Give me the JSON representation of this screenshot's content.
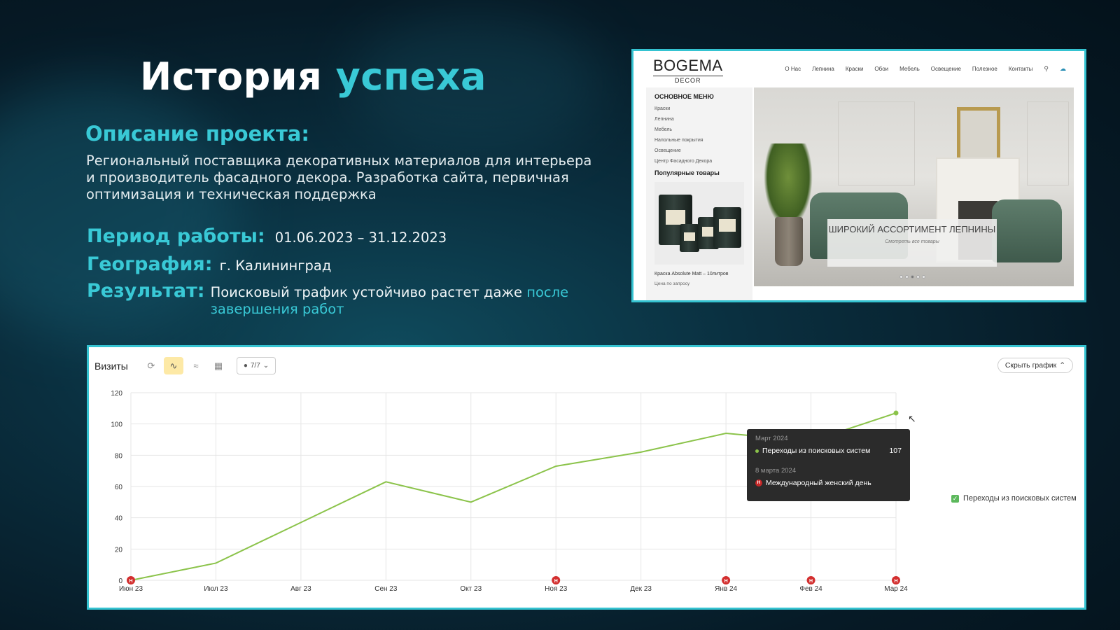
{
  "slide": {
    "title_main": "История",
    "title_accent": "успеха",
    "subhead": "Описание проекта:",
    "description": "Региональный поставщика декоративных материалов для интерьера и производитель фасадного декора. Разработка сайта, первичная оптимизация и техническая поддержка",
    "period_label": "Период работы:",
    "period_value": "01.06.2023 – 31.12.2023",
    "geo_label": "География:",
    "geo_value": "г. Калининград",
    "result_label": "Результат:",
    "result_text": "Поисковый трафик устойчиво растет даже ",
    "result_highlight": "после завершения работ",
    "accent_color": "#39c9d6"
  },
  "site": {
    "logo_main": "BOGEMA",
    "logo_sub": "DECOR",
    "nav": [
      "О Нас",
      "Лепнина",
      "Краски",
      "Обои",
      "Мебель",
      "Освещение",
      "Полезное",
      "Контакты"
    ],
    "sidebar_heading": "ОСНОВНОЕ МЕНЮ",
    "sidebar_items": [
      "Краски",
      "Лепнина",
      "Мебель",
      "Напольные покрытия",
      "Освещение",
      "Центр Фасадного Декора"
    ],
    "popular_heading": "Популярные товары",
    "product_name": "Краска Absolute Matt – 10литров",
    "product_price": "Цена по запросу",
    "banner_title": "ШИРОКИЙ АССОРТИМЕНТ ЛЕПНИНЫ",
    "banner_link": "Смотреть все товары"
  },
  "panel": {
    "title": "Визиты",
    "dropdown_value": "7/7",
    "hide_button": "Скрыть график",
    "legend_label": "Переходы из поисковых систем",
    "tooltip": {
      "month": "Март 2024",
      "series": "Переходы из поисковых систем",
      "value": "107",
      "event_date": "8 марта 2024",
      "event_badge": "Н",
      "event_name": "Международный женский день"
    }
  },
  "chart_data": {
    "type": "line",
    "x": [
      "Июн 23",
      "Июл 23",
      "Авг 23",
      "Сен 23",
      "Окт 23",
      "Ноя 23",
      "Дек 23",
      "Янв 24",
      "Фев 24",
      "Мар 24"
    ],
    "series": [
      {
        "name": "Переходы из поисковых систем",
        "values": [
          0,
          11,
          37,
          63,
          50,
          73,
          82,
          94,
          89,
          107
        ],
        "color": "#8bc34a"
      }
    ],
    "yticks": [
      0,
      20,
      40,
      60,
      80,
      100,
      120
    ],
    "ylim": [
      0,
      120
    ],
    "grid": true,
    "event_markers": [
      "Июн 23",
      "Ноя 23",
      "Янв 24",
      "Фев 24",
      "Мар 24"
    ],
    "marker_label": "Н",
    "legend": "right"
  }
}
